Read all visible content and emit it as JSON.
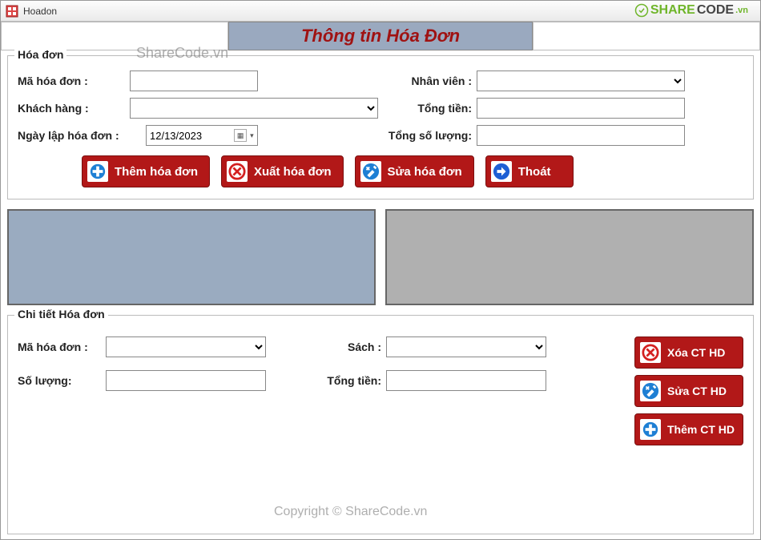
{
  "window": {
    "title": "Hoadon"
  },
  "banner": {
    "title": "Thông tin Hóa Đơn"
  },
  "watermarks": {
    "logo": "SHARECODE.vn",
    "text1": "ShareCode.vn",
    "text2": "Copyright © ShareCode.vn"
  },
  "group_hoadon": {
    "title": "Hóa đơn",
    "labels": {
      "mahd": "Mã hóa đơn :",
      "khachhang": "Khách hàng :",
      "ngaylap": "Ngày lập hóa đơn :",
      "nhanvien": "Nhân viên :",
      "tongtien": "Tổng tiền:",
      "tongsl": "Tổng số lượng:"
    },
    "values": {
      "mahd": "",
      "khachhang": "",
      "ngaylap": "12/13/2023",
      "nhanvien": "",
      "tongtien": "",
      "tongsl": ""
    },
    "buttons": {
      "them": "Thêm hóa đơn",
      "xuat": "Xuất hóa đơn",
      "sua": "Sửa hóa đơn",
      "thoat": "Thoát"
    }
  },
  "group_chitiet": {
    "title": "Chi tiết Hóa đơn",
    "labels": {
      "mahd": "Mã hóa đơn :",
      "soluong": "Số lượng:",
      "sach": "Sách :",
      "tongtien": "Tổng tiền:"
    },
    "values": {
      "mahd": "",
      "soluong": "",
      "sach": "",
      "tongtien": ""
    },
    "buttons": {
      "xoa": "Xóa CT HD",
      "sua": "Sửa CT HD",
      "them": "Thêm CT HD"
    }
  }
}
